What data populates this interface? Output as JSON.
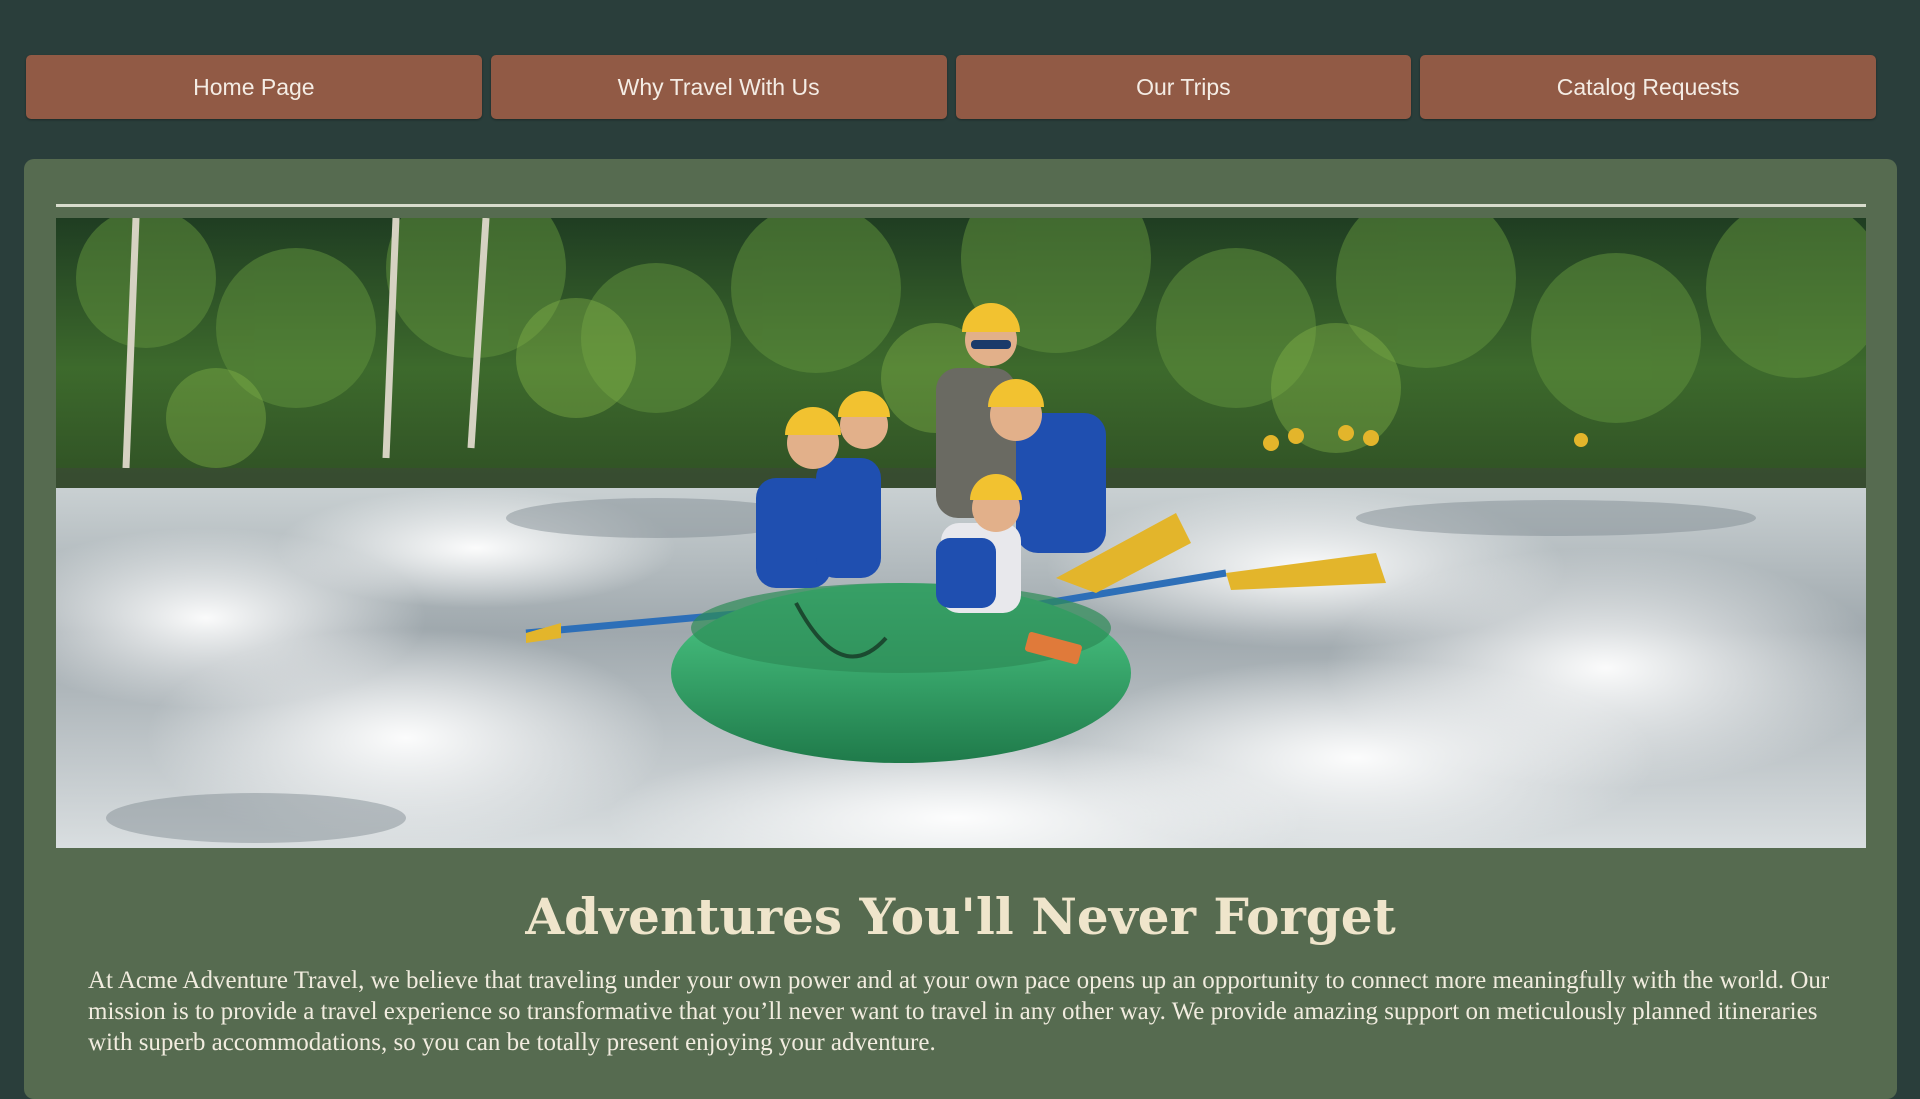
{
  "nav": {
    "items": [
      {
        "label": "Home Page"
      },
      {
        "label": "Why Travel With Us"
      },
      {
        "label": "Our Trips"
      },
      {
        "label": "Catalog Requests"
      }
    ]
  },
  "hero": {
    "image": "whitewater-rafting-photo",
    "icon": "rafting-photo-icon"
  },
  "main": {
    "headline": "Adventures You'll Never Forget",
    "body": "At Acme Adventure Travel, we believe that traveling under your own power and at your own pace opens up an opportunity to connect more meaningfully with the world. Our mission is to provide a travel experience so transformative that you’ll never want to travel in any other way. We provide amazing support on meticulously planned itineraries with superb accommodations, so you can be totally present enjoying your adventure."
  },
  "colors": {
    "page_background": "#2a3e3b",
    "nav_button": "#915a45",
    "content_panel": "#566b50",
    "headline": "#efe5cb",
    "body_text": "#f1ecdf"
  }
}
